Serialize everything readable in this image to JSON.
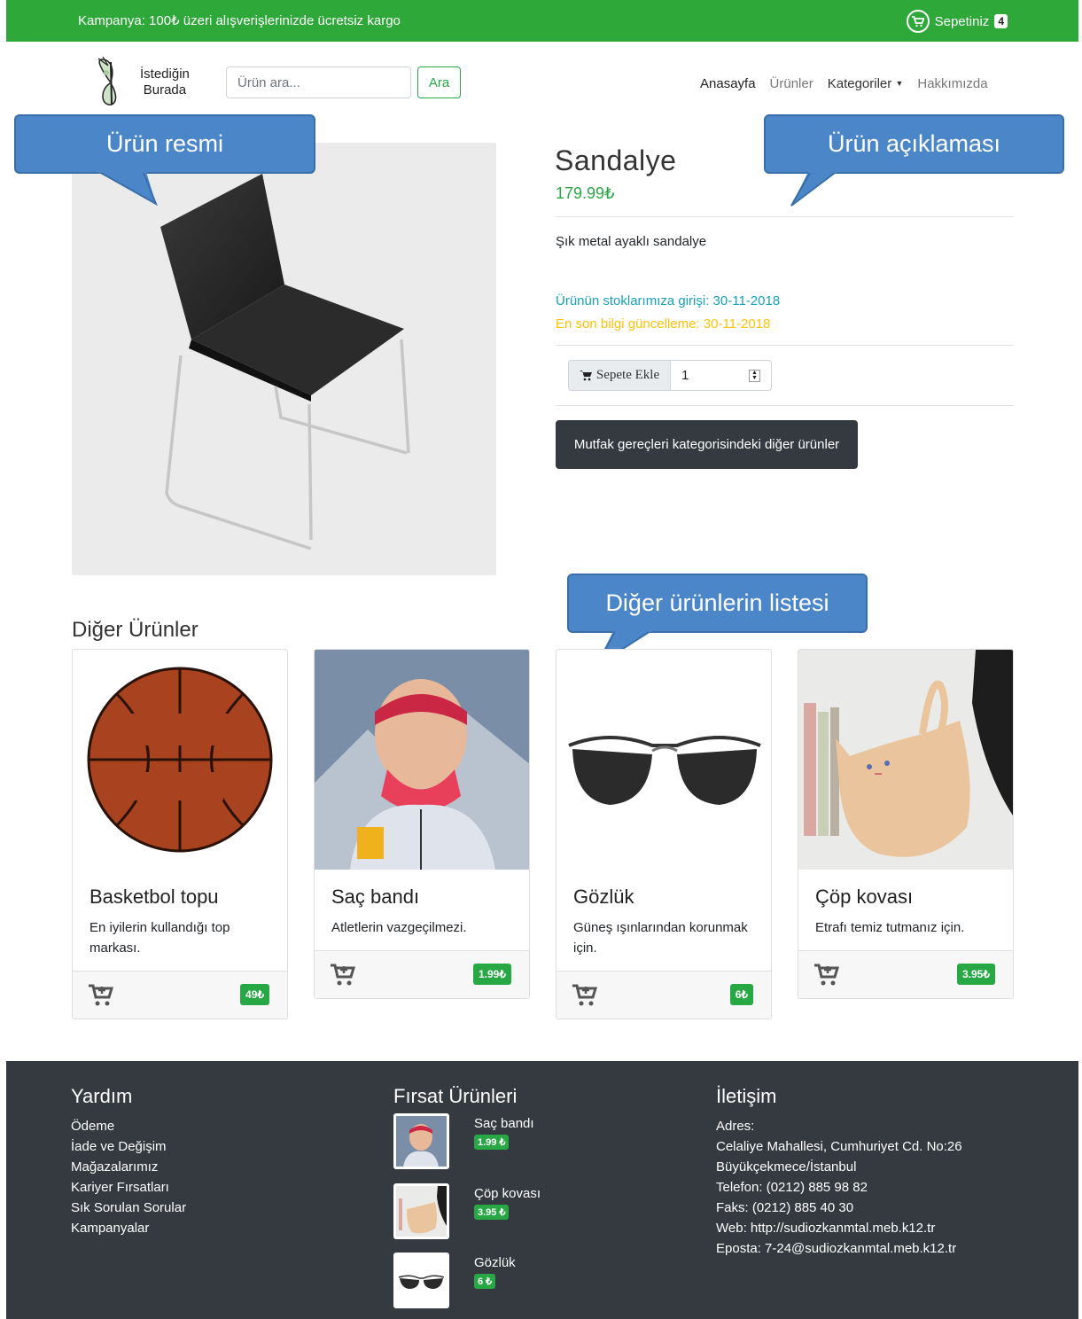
{
  "topbar": {
    "promo": "Kampanya: 100₺ üzeri alışverişlerinizde ücretsiz kargo",
    "cart_label": "Sepetiniz",
    "cart_count": "4"
  },
  "header": {
    "logo_line1": "İstediğin",
    "logo_line2": "Burada",
    "search_placeholder": "Ürün ara...",
    "search_button": "Ara",
    "nav": {
      "home": "Anasayfa",
      "products": "Ürünler",
      "categories": "Kategoriler",
      "about": "Hakkımızda"
    }
  },
  "product": {
    "title": "Sandalye",
    "price": "179.99₺",
    "description": "Şık metal ayaklı sandalye",
    "stock_date": "Ürünün stoklarımıza girişi: 30-11-2018",
    "update_date": "En son bilgi güncelleme: 30-11-2018",
    "add_to_cart": "Sepete Ekle",
    "quantity": "1",
    "category_button": "Mutfak gereçleri kategorisindeki diğer ürünler"
  },
  "callouts": {
    "image": "Ürün resmi",
    "description": "Ürün açıklaması",
    "others": "Diğer ürünlerin listesi"
  },
  "others": {
    "title": "Diğer Ürünler",
    "items": [
      {
        "title": "Basketbol topu",
        "text": "En iyilerin kullandığı top markası.",
        "price": "49₺"
      },
      {
        "title": "Saç bandı",
        "text": "Atletlerin vazgeçilmezi.",
        "price": "1.99₺"
      },
      {
        "title": "Gözlük",
        "text": "Güneş ışınlarından korunmak için.",
        "price": "6₺"
      },
      {
        "title": "Çöp kovası",
        "text": "Etrafı temiz tutmanız için.",
        "price": "3.95₺"
      }
    ]
  },
  "footer": {
    "help": {
      "title": "Yardım",
      "links": [
        "Ödeme",
        "İade ve Değişim",
        "Mağazalarımız",
        "Kariyer Fırsatları",
        "Sık Sorulan Sorular",
        "Kampanyalar"
      ]
    },
    "deals": {
      "title": "Fırsat Ürünleri",
      "items": [
        {
          "name": "Saç bandı",
          "price": "1.99 ₺"
        },
        {
          "name": "Çöp kovası",
          "price": "3.95 ₺"
        },
        {
          "name": "Gözlük",
          "price": "6 ₺"
        }
      ]
    },
    "contact": {
      "title": "İletişim",
      "lines": [
        "Adres:",
        "Celaliye Mahallesi, Cumhuriyet Cd. No:26",
        "Büyükçekmece/İstanbul",
        "Telefon: (0212) 885 98 82",
        "Faks: (0212) 885 40 30",
        "Web: http://sudiozkanmtal.meb.k12.tr",
        "Eposta: 7-24@sudiozkanmtal.meb.k12.tr"
      ]
    }
  },
  "colors": {
    "brand_green": "#2fa83a",
    "success": "#28a745",
    "dark": "#343a40",
    "callout": "#4a86c8",
    "info": "#17a2b8",
    "warning": "#ffc107"
  }
}
